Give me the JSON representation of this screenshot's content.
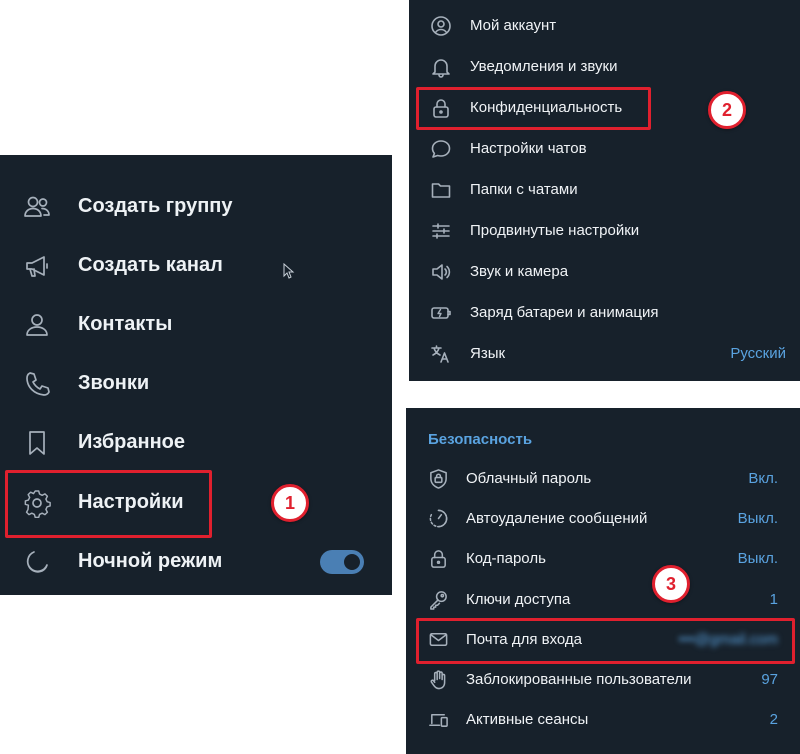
{
  "main_menu": {
    "items": [
      {
        "label": "Создать группу",
        "icon": "people-icon"
      },
      {
        "label": "Создать канал",
        "icon": "megaphone-icon"
      },
      {
        "label": "Контакты",
        "icon": "person-icon"
      },
      {
        "label": "Звонки",
        "icon": "phone-icon"
      },
      {
        "label": "Избранное",
        "icon": "bookmark-icon"
      },
      {
        "label": "Настройки",
        "icon": "gear-icon"
      },
      {
        "label": "Ночной режим",
        "icon": "moon-icon",
        "toggle": true
      }
    ],
    "night_mode_on": true
  },
  "settings_menu": {
    "items": [
      {
        "label": "Мой аккаунт",
        "icon": "account-circle-icon"
      },
      {
        "label": "Уведомления и звуки",
        "icon": "bell-icon"
      },
      {
        "label": "Конфиденциальность",
        "icon": "lock-icon"
      },
      {
        "label": "Настройки чатов",
        "icon": "chat-bubble-icon"
      },
      {
        "label": "Папки с чатами",
        "icon": "folder-icon"
      },
      {
        "label": "Продвинутые настройки",
        "icon": "sliders-icon"
      },
      {
        "label": "Звук и камера",
        "icon": "speaker-icon"
      },
      {
        "label": "Заряд батареи и анимация",
        "icon": "battery-icon"
      },
      {
        "label": "Язык",
        "icon": "translate-icon",
        "value": "Русский"
      }
    ]
  },
  "security": {
    "section_title": "Безопасность",
    "items": [
      {
        "label": "Облачный пароль",
        "icon": "shield-lock-icon",
        "value": "Вкл."
      },
      {
        "label": "Автоудаление сообщений",
        "icon": "timer-icon",
        "value": "Выкл."
      },
      {
        "label": "Код-пароль",
        "icon": "lock-icon",
        "value": "Выкл."
      },
      {
        "label": "Ключи доступа",
        "icon": "key-icon",
        "value": "1"
      },
      {
        "label": "Почта для входа",
        "icon": "mail-icon",
        "value": "•••@gmail.com",
        "blurred": true
      },
      {
        "label": "Заблокированные пользователи",
        "icon": "hand-icon",
        "value": "97"
      },
      {
        "label": "Активные сеансы",
        "icon": "devices-icon",
        "value": "2"
      }
    ]
  },
  "badges": {
    "one": "1",
    "two": "2",
    "three": "3"
  },
  "colors": {
    "panel_bg": "#17212b",
    "accent": "#5aa3e0",
    "highlight": "#e0202e",
    "text": "#f0f3f6",
    "icon": "#a6b0bb"
  }
}
